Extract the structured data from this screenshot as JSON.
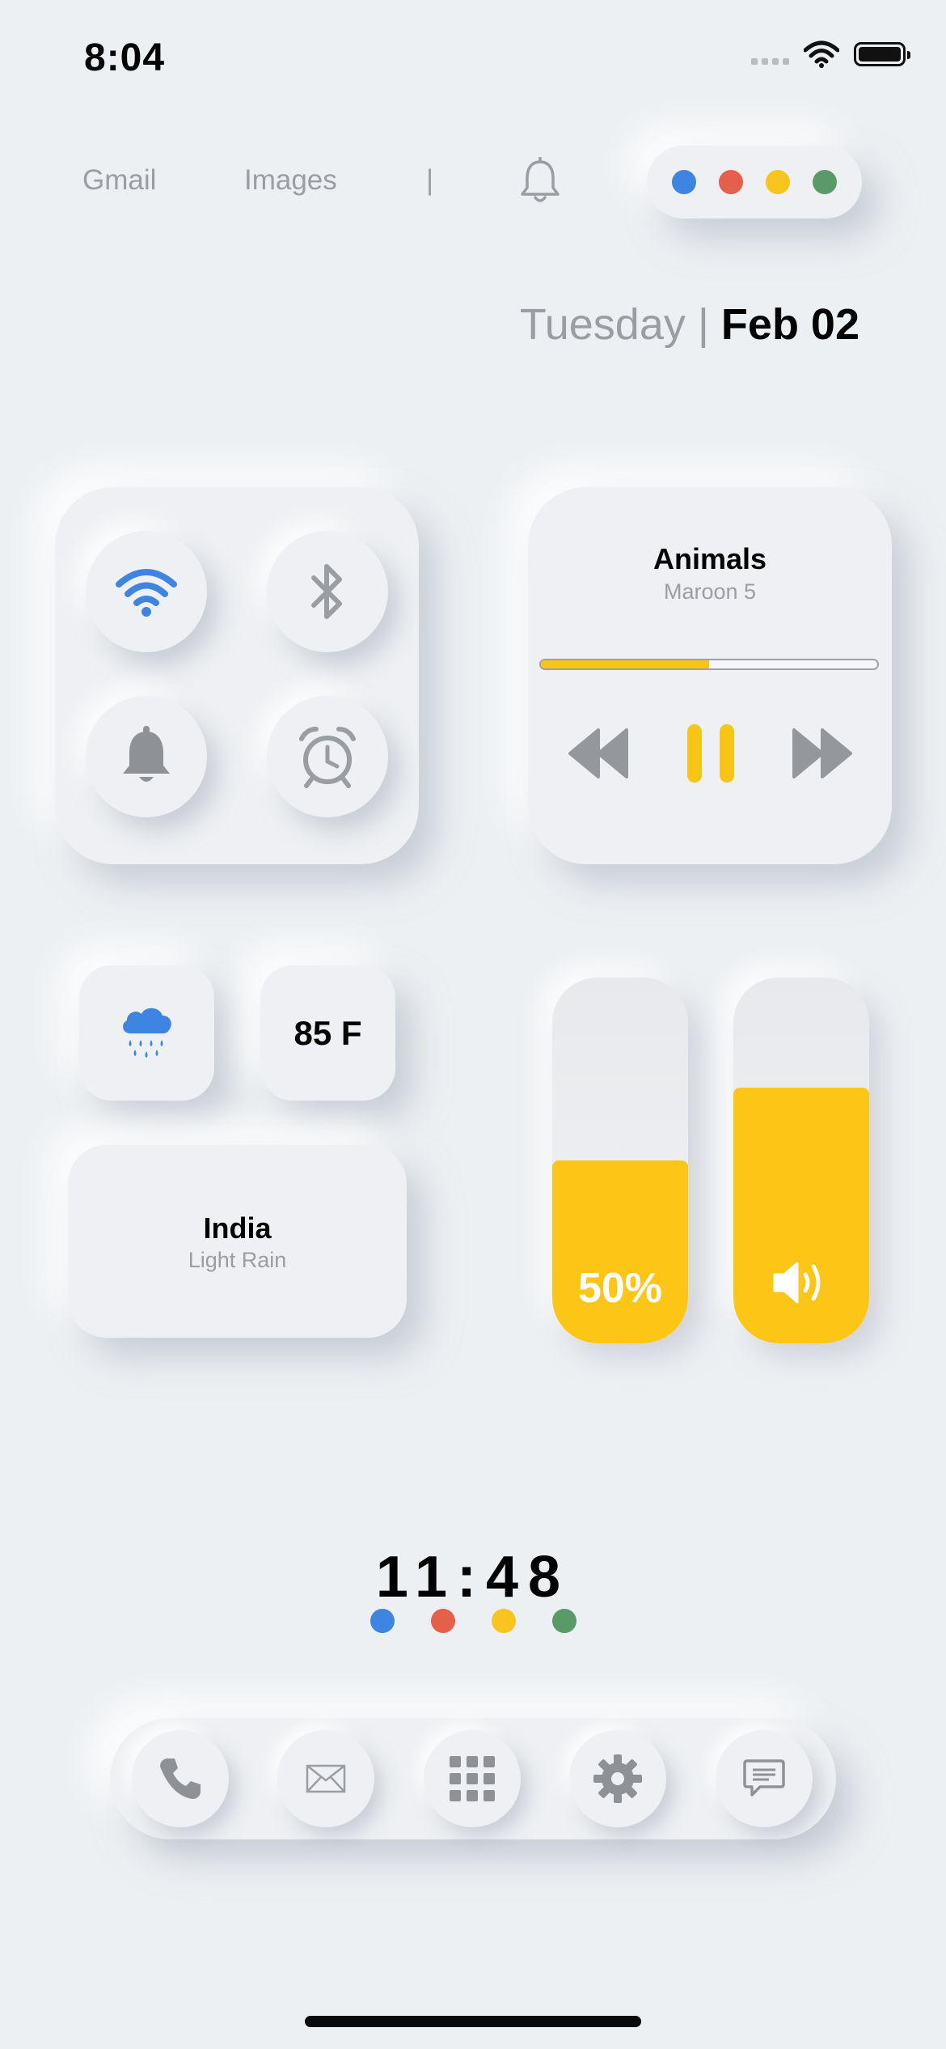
{
  "status_bar": {
    "time": "8:04",
    "icons": [
      "cellular-signal-icon",
      "wifi-icon",
      "battery-icon"
    ]
  },
  "top_nav": {
    "links": [
      "Gmail",
      "Images",
      "|"
    ],
    "bell_icon": "bell-outline-icon",
    "dot_colors": [
      "#3d85e0",
      "#e5604a",
      "#f8c41d",
      "#5a9a67"
    ]
  },
  "date": {
    "day": "Tuesday",
    "separator": "|",
    "date": "Feb 02"
  },
  "control_panel": {
    "toggles": [
      {
        "icon": "wifi-icon",
        "active": true,
        "color": "#3d85e0"
      },
      {
        "icon": "bluetooth-icon",
        "active": false
      },
      {
        "icon": "bell-icon",
        "active": false
      },
      {
        "icon": "alarm-clock-icon",
        "active": false
      }
    ]
  },
  "music": {
    "title": "Animals",
    "artist": "Maroon 5",
    "progress": 0.5,
    "controls": [
      "rewind-icon",
      "pause-icon",
      "fast-forward-icon"
    ],
    "accent": "#f7c614"
  },
  "weather": {
    "icon": "rain-cloud-icon",
    "temperature": "85 F",
    "location": "India",
    "condition": "Light Rain"
  },
  "sliders": {
    "brightness": {
      "value": 0.5,
      "label": "50%"
    },
    "volume": {
      "value": 0.7,
      "icon": "speaker-icon"
    },
    "accent": "#fdc516"
  },
  "clock": {
    "time": "11:48",
    "dot_colors": [
      "#3d85e0",
      "#e5604a",
      "#f8c41d",
      "#5a9a67"
    ]
  },
  "dock": {
    "apps": [
      "phone-icon",
      "mail-icon",
      "apps-grid-icon",
      "settings-gear-icon",
      "messages-icon"
    ]
  }
}
